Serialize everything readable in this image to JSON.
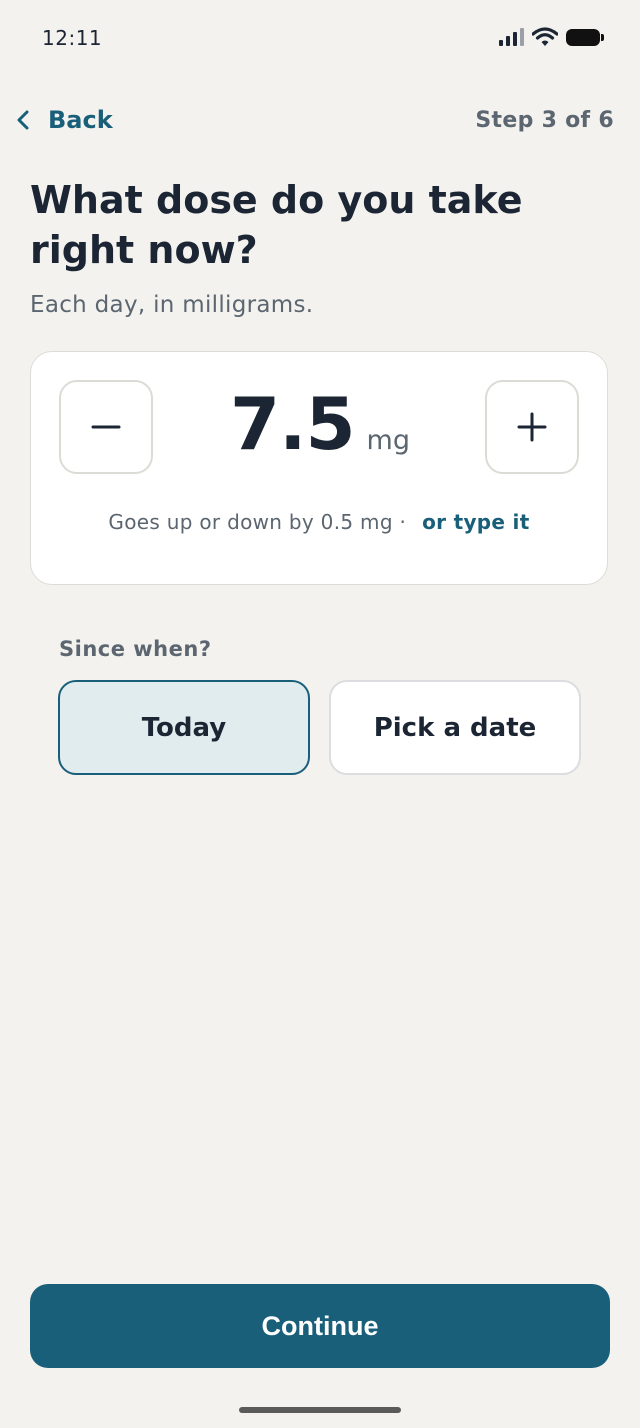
{
  "status_bar": {
    "time": "12:11"
  },
  "nav": {
    "back_label": "Back",
    "step_label": "Step 3 of 6"
  },
  "page": {
    "title": "What dose do you take right now?",
    "subtitle": "Each day, in milligrams."
  },
  "dose": {
    "value": "7.5",
    "unit": "mg",
    "hint": "Goes up or down by 0.5 mg ·",
    "type_it_label": "or type it"
  },
  "since": {
    "label": "Since when?",
    "options": [
      {
        "label": "Today",
        "selected": true
      },
      {
        "label": "Pick a date",
        "selected": false
      }
    ]
  },
  "footer": {
    "continue_label": "Continue"
  },
  "colors": {
    "accent": "#1a5f7a",
    "background": "#f3f2ee",
    "selected_fill": "#e1ecee"
  }
}
